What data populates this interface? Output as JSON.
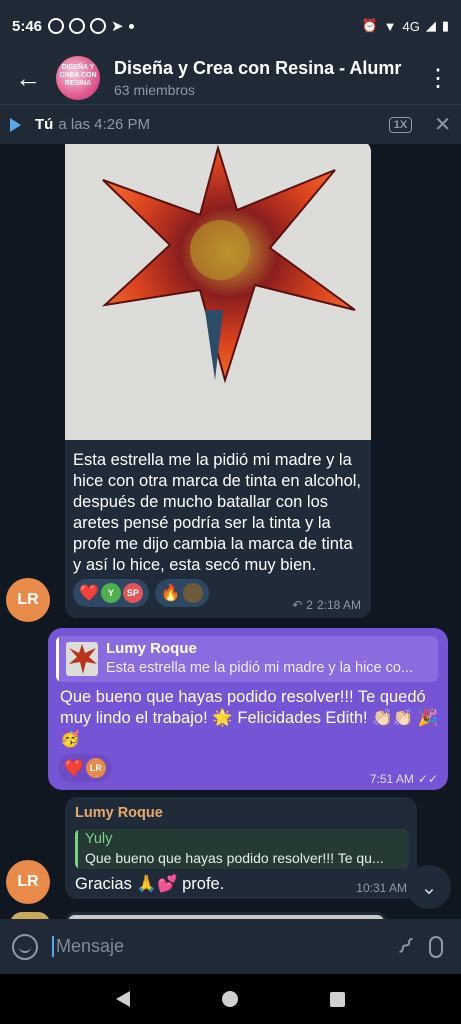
{
  "status_bar": {
    "time": "5:46",
    "network": "4G"
  },
  "header": {
    "back_icon": "arrow-left-icon",
    "group_avatar_text": "DISEÑA Y CREA CON RESINA",
    "title": "Diseña y Crea con Resina - Alumr",
    "subtitle": "63 miembros",
    "menu_icon": "more-vertical-icon"
  },
  "player": {
    "name": "Tú",
    "time": "a las 4:26 PM",
    "speed": "1X",
    "close": "✕"
  },
  "messages": {
    "m1": {
      "photo_desc": "resin-star-photo",
      "text": "Esta estrella me la pidió mi madre y la hice con otra marca de tinta en alcohol, después de mucho batallar con los aretes pensé podría ser la tinta y la profe me dijo cambia la marca de tinta y así lo hice, esta secó muy bien.",
      "reactions": [
        {
          "emoji": "❤️",
          "avatars": [
            "Y",
            "SP"
          ]
        },
        {
          "emoji": "🔥"
        }
      ],
      "replies_count": "2",
      "time": "2:18 AM"
    },
    "m2": {
      "reply_name": "Lumy Roque",
      "reply_text": "Esta estrella me la pidió mi madre y la hice co...",
      "text": "Que bueno que hayas podido resolver!!! Te quedó muy lindo el trabajo! 🌟 Felicidades Edith! 👏🏻👏🏻 🎉🥳",
      "reaction_emoji": "❤️",
      "reaction_avatar": "LR",
      "time": "7:51 AM"
    },
    "m3": {
      "sender": "Lumy Roque",
      "reply_name": "Yuly",
      "reply_text": "Que bueno que hayas podido resolver!!! Te qu...",
      "text": "Gracias 🙏💕 profe.",
      "time": "10:31 AM"
    }
  },
  "avatars": {
    "lr": "LR"
  },
  "input": {
    "placeholder": "Mensaje"
  },
  "colors": {
    "accent_blue": "#5aa9ec",
    "outgoing_bubble": "#7654d6",
    "incoming_bubble": "#1f2b38",
    "sender_name": "#e8a96a",
    "reply_name_yuly": "#7ed18a"
  }
}
